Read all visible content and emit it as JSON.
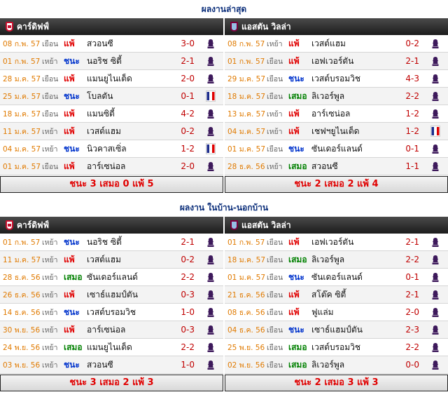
{
  "recent": {
    "title": "ผลงานล่าสุด",
    "home": {
      "team": "คาร์ดิฟฟ์",
      "crest": "cardiff-crest-icon",
      "matches": [
        {
          "date": "08 ก.พ. 57",
          "venue": "เยือน",
          "result": "แพ้",
          "type": "loss",
          "opponent": "สวอนซี",
          "score": "3-0",
          "comp": "premier-league-icon"
        },
        {
          "date": "01 ก.พ. 57",
          "venue": "เหย้า",
          "result": "ชนะ",
          "type": "win",
          "opponent": "นอริช ซิตี้",
          "score": "2-1",
          "comp": "premier-league-icon"
        },
        {
          "date": "28 ม.ค. 57",
          "venue": "เยือน",
          "result": "แพ้",
          "type": "loss",
          "opponent": "แมนยูไนเต็ด",
          "score": "2-0",
          "comp": "premier-league-icon"
        },
        {
          "date": "25 ม.ค. 57",
          "venue": "เยือน",
          "result": "ชนะ",
          "type": "win",
          "opponent": "โบลตัน",
          "score": "0-1",
          "comp": "fa-cup-icon"
        },
        {
          "date": "18 ม.ค. 57",
          "venue": "เยือน",
          "result": "แพ้",
          "type": "loss",
          "opponent": "แมนซิตี้",
          "score": "4-2",
          "comp": "premier-league-icon"
        },
        {
          "date": "11 ม.ค. 57",
          "venue": "เหย้า",
          "result": "แพ้",
          "type": "loss",
          "opponent": "เวสต์แฮม",
          "score": "0-2",
          "comp": "premier-league-icon"
        },
        {
          "date": "04 ม.ค. 57",
          "venue": "เหย้า",
          "result": "ชนะ",
          "type": "win",
          "opponent": "นิวคาสเซิ่ล",
          "score": "1-2",
          "comp": "fa-cup-icon"
        },
        {
          "date": "01 ม.ค. 57",
          "venue": "เยือน",
          "result": "แพ้",
          "type": "loss",
          "opponent": "อาร์เซน่อล",
          "score": "2-0",
          "comp": "premier-league-icon"
        }
      ],
      "summary": "ชนะ 3 เสมอ 0 แพ้ 5"
    },
    "away": {
      "team": "แอสตัน วิลล่า",
      "crest": "aston-villa-crest-icon",
      "matches": [
        {
          "date": "08 ก.พ. 57",
          "venue": "เหย้า",
          "result": "แพ้",
          "type": "loss",
          "opponent": "เวสต์แฮม",
          "score": "0-2",
          "comp": "premier-league-icon"
        },
        {
          "date": "01 ก.พ. 57",
          "venue": "เยือน",
          "result": "แพ้",
          "type": "loss",
          "opponent": "เอฟเวอร์ตัน",
          "score": "2-1",
          "comp": "premier-league-icon"
        },
        {
          "date": "29 ม.ค. 57",
          "venue": "เยือน",
          "result": "ชนะ",
          "type": "win",
          "opponent": "เวสต์บรอมวิช",
          "score": "4-3",
          "comp": "premier-league-icon"
        },
        {
          "date": "18 ม.ค. 57",
          "venue": "เยือน",
          "result": "เสมอ",
          "type": "draw",
          "opponent": "ลิเวอร์พูล",
          "score": "2-2",
          "comp": "premier-league-icon"
        },
        {
          "date": "13 ม.ค. 57",
          "venue": "เหย้า",
          "result": "แพ้",
          "type": "loss",
          "opponent": "อาร์เซน่อล",
          "score": "1-2",
          "comp": "premier-league-icon"
        },
        {
          "date": "04 ม.ค. 57",
          "venue": "เหย้า",
          "result": "แพ้",
          "type": "loss",
          "opponent": "เชฟฯยูไนเต็ด",
          "score": "1-2",
          "comp": "fa-cup-icon"
        },
        {
          "date": "01 ม.ค. 57",
          "venue": "เยือน",
          "result": "ชนะ",
          "type": "win",
          "opponent": "ซันเดอร์แลนด์",
          "score": "0-1",
          "comp": "premier-league-icon"
        },
        {
          "date": "28 ธ.ค. 56",
          "venue": "เหย้า",
          "result": "เสมอ",
          "type": "draw",
          "opponent": "สวอนซี",
          "score": "1-1",
          "comp": "premier-league-icon"
        }
      ],
      "summary": "ชนะ 2 เสมอ 2 แพ้ 4"
    }
  },
  "homeaway": {
    "title": "ผลงาน ในบ้าน-นอกบ้าน",
    "home": {
      "team": "คาร์ดิฟฟ์",
      "crest": "cardiff-crest-icon",
      "matches": [
        {
          "date": "01 ก.พ. 57",
          "venue": "เหย้า",
          "result": "ชนะ",
          "type": "win",
          "opponent": "นอริช ซิตี้",
          "score": "2-1",
          "comp": "premier-league-icon"
        },
        {
          "date": "11 ม.ค. 57",
          "venue": "เหย้า",
          "result": "แพ้",
          "type": "loss",
          "opponent": "เวสต์แฮม",
          "score": "0-2",
          "comp": "premier-league-icon"
        },
        {
          "date": "28 ธ.ค. 56",
          "venue": "เหย้า",
          "result": "เสมอ",
          "type": "draw",
          "opponent": "ซันเดอร์แลนด์",
          "score": "2-2",
          "comp": "premier-league-icon"
        },
        {
          "date": "26 ธ.ค. 56",
          "venue": "เหย้า",
          "result": "แพ้",
          "type": "loss",
          "opponent": "เซาธ์แฮมป์ตัน",
          "score": "0-3",
          "comp": "premier-league-icon"
        },
        {
          "date": "14 ธ.ค. 56",
          "venue": "เหย้า",
          "result": "ชนะ",
          "type": "win",
          "opponent": "เวสต์บรอมวิช",
          "score": "1-0",
          "comp": "premier-league-icon"
        },
        {
          "date": "30 พ.ย. 56",
          "venue": "เหย้า",
          "result": "แพ้",
          "type": "loss",
          "opponent": "อาร์เซน่อล",
          "score": "0-3",
          "comp": "premier-league-icon"
        },
        {
          "date": "24 พ.ย. 56",
          "venue": "เหย้า",
          "result": "เสมอ",
          "type": "draw",
          "opponent": "แมนยูไนเต็ด",
          "score": "2-2",
          "comp": "premier-league-icon"
        },
        {
          "date": "03 พ.ย. 56",
          "venue": "เหย้า",
          "result": "ชนะ",
          "type": "win",
          "opponent": "สวอนซี",
          "score": "1-0",
          "comp": "premier-league-icon"
        }
      ],
      "summary": "ชนะ 3 เสมอ 2 แพ้ 3"
    },
    "away": {
      "team": "แอสตัน วิลล่า",
      "crest": "aston-villa-crest-icon",
      "matches": [
        {
          "date": "01 ก.พ. 57",
          "venue": "เยือน",
          "result": "แพ้",
          "type": "loss",
          "opponent": "เอฟเวอร์ตัน",
          "score": "2-1",
          "comp": "premier-league-icon"
        },
        {
          "date": "18 ม.ค. 57",
          "venue": "เยือน",
          "result": "เสมอ",
          "type": "draw",
          "opponent": "ลิเวอร์พูล",
          "score": "2-2",
          "comp": "premier-league-icon"
        },
        {
          "date": "01 ม.ค. 57",
          "venue": "เยือน",
          "result": "ชนะ",
          "type": "win",
          "opponent": "ซันเดอร์แลนด์",
          "score": "0-1",
          "comp": "premier-league-icon"
        },
        {
          "date": "21 ธ.ค. 56",
          "venue": "เยือน",
          "result": "แพ้",
          "type": "loss",
          "opponent": "สโต๊ค ซิตี้",
          "score": "2-1",
          "comp": "premier-league-icon"
        },
        {
          "date": "08 ธ.ค. 56",
          "venue": "เยือน",
          "result": "แพ้",
          "type": "loss",
          "opponent": "ฟูแล่ม",
          "score": "2-0",
          "comp": "premier-league-icon"
        },
        {
          "date": "04 ธ.ค. 56",
          "venue": "เยือน",
          "result": "ชนะ",
          "type": "win",
          "opponent": "เซาธ์แฮมป์ตัน",
          "score": "2-3",
          "comp": "premier-league-icon"
        },
        {
          "date": "25 พ.ย. 56",
          "venue": "เยือน",
          "result": "เสมอ",
          "type": "draw",
          "opponent": "เวสต์บรอมวิช",
          "score": "2-2",
          "comp": "premier-league-icon"
        },
        {
          "date": "02 พ.ย. 56",
          "venue": "เยือน",
          "result": "เสมอ",
          "type": "draw",
          "opponent": "ลิเวอร์พูล",
          "score": "0-0",
          "comp": "premier-league-icon"
        }
      ],
      "summary": "ชนะ 2 เสมอ 3 แพ้ 3"
    }
  }
}
